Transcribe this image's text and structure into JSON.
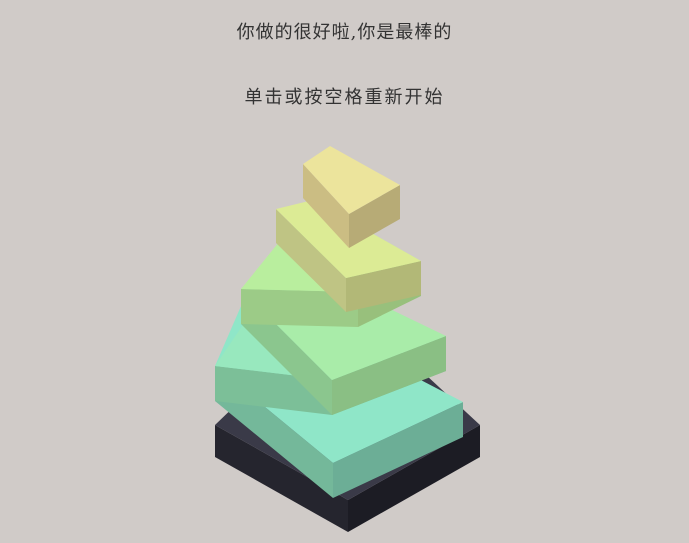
{
  "game": {
    "message": "你做的很好啦,你是最棒的",
    "restart_hint": "单击或按空格重新开始"
  },
  "colors": {
    "background": "#d0cbc8",
    "text": "#333333",
    "base_top": "#3a3a48",
    "base_left": "#25252e",
    "base_right": "#1c1c24"
  },
  "stack": {
    "block_count": 6,
    "block_colors": [
      {
        "top": "#8fe6c8",
        "left": "#74b89a",
        "right": "#6cae96"
      },
      {
        "top": "#98e8be",
        "left": "#7cbf98",
        "right": "#7cba8e"
      },
      {
        "top": "#a9eca9",
        "left": "#8bc68e",
        "right": "#8abf84"
      },
      {
        "top": "#b9ee9e",
        "left": "#9ccb87",
        "right": "#98c07c"
      },
      {
        "top": "#dceb95",
        "left": "#bfc484",
        "right": "#b2b877"
      },
      {
        "top": "#ece49c",
        "left": "#cbbd83",
        "right": "#b7ab76"
      }
    ]
  }
}
